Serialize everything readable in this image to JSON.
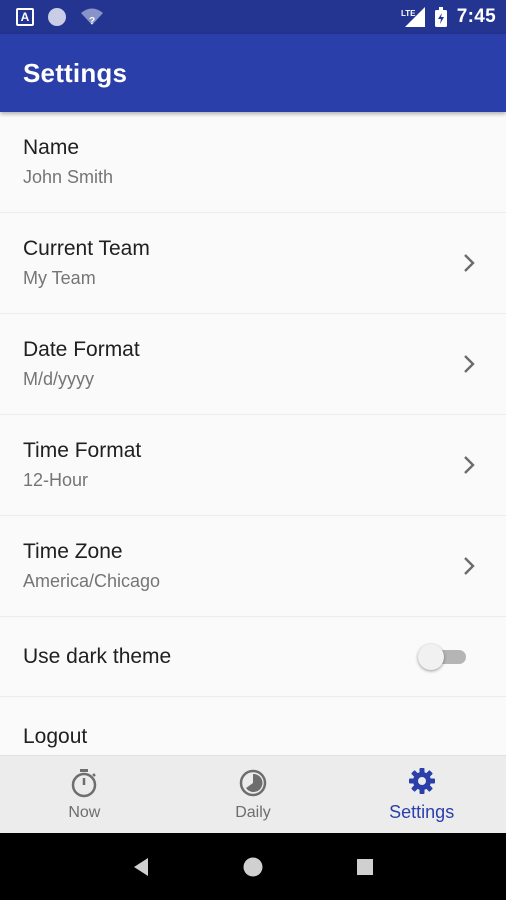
{
  "status_bar": {
    "time": "7:45",
    "network_label": "LTE"
  },
  "app_bar": {
    "title": "Settings"
  },
  "settings": {
    "name": {
      "title": "Name",
      "value": "John Smith"
    },
    "current_team": {
      "title": "Current Team",
      "value": "My Team"
    },
    "date_format": {
      "title": "Date Format",
      "value": "M/d/yyyy"
    },
    "time_format": {
      "title": "Time Format",
      "value": "12-Hour"
    },
    "time_zone": {
      "title": "Time Zone",
      "value": "America/Chicago"
    },
    "dark_theme": {
      "title": "Use dark theme",
      "enabled": false
    },
    "logout": {
      "title": "Logout"
    }
  },
  "bottom_nav": {
    "items": [
      {
        "label": "Now",
        "icon": "stopwatch-icon",
        "active": false
      },
      {
        "label": "Daily",
        "icon": "clock-pie-icon",
        "active": false
      },
      {
        "label": "Settings",
        "icon": "gear-icon",
        "active": true
      }
    ]
  },
  "colors": {
    "status_bar": "#233491",
    "app_bar": "#2b3faa",
    "accent": "#2b3faa"
  }
}
